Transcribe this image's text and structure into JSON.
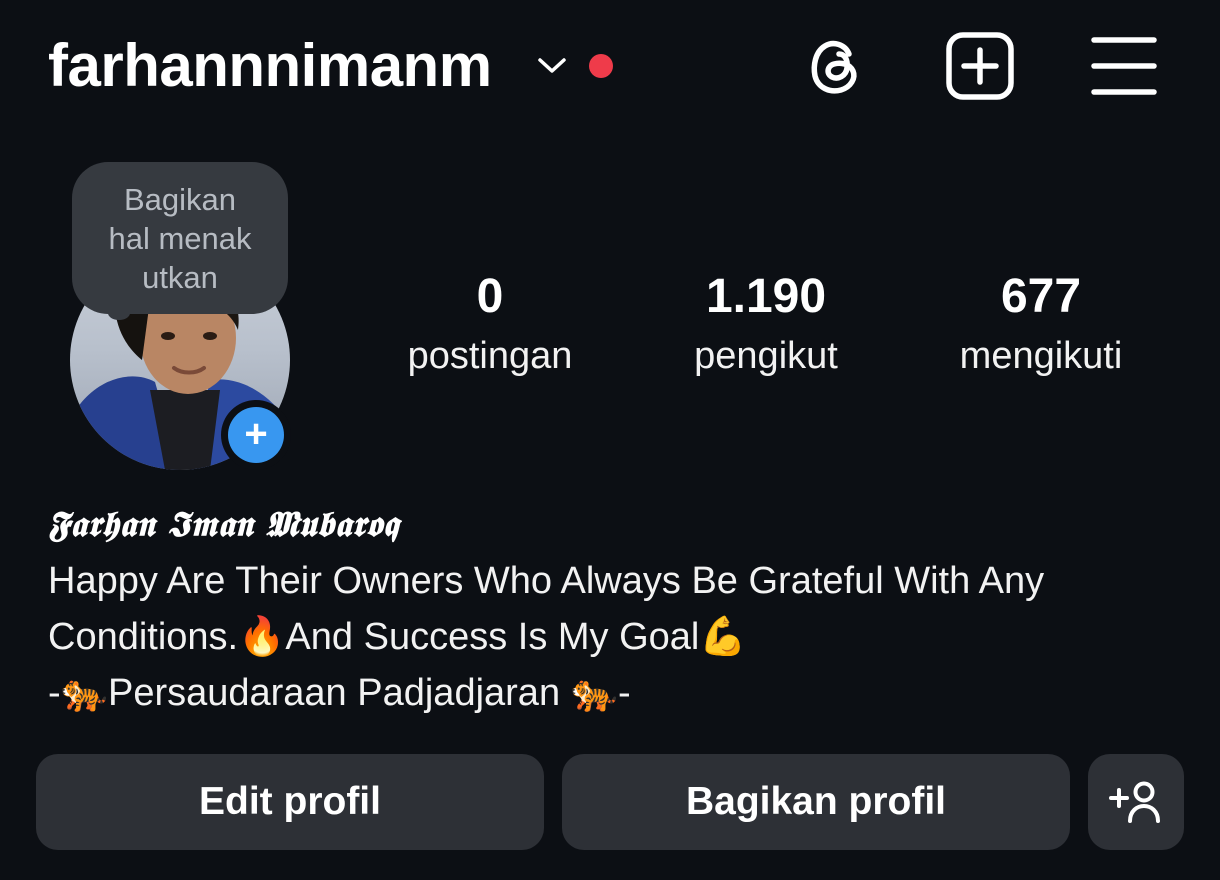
{
  "header": {
    "username": "farhannnimanm",
    "notification_dot_color": "#ef3b4a",
    "icons": [
      "chevron-down-icon",
      "threads-icon",
      "new-post-icon",
      "menu-icon"
    ]
  },
  "profile": {
    "note": "Bagikan hal menak utkan",
    "note_lines": [
      "Bagikan",
      "hal menak",
      "utkan"
    ],
    "add_story_color": "#3897f0",
    "stats": {
      "posts": {
        "value": "0",
        "label": "postingan"
      },
      "followers": {
        "value": "1.190",
        "label": "pengikut"
      },
      "following": {
        "value": "677",
        "label": "mengikuti"
      }
    },
    "full_name": "𝕱𝖆𝖗𝖍𝖆𝖓 𝕴𝖒𝖆𝖓 𝕸𝖚𝖇𝖆𝖗𝖔𝖖",
    "bio_lines": [
      "Happy Are Their Owners Who Always Be Grateful With Any",
      "Conditions.🔥And Success Is My Goal💪",
      "-🐅Persaudaraan Padjadjaran 🐅-"
    ]
  },
  "buttons": {
    "edit": "Edit profil",
    "share": "Bagikan profil",
    "add_person_icon": "add-person-icon"
  }
}
